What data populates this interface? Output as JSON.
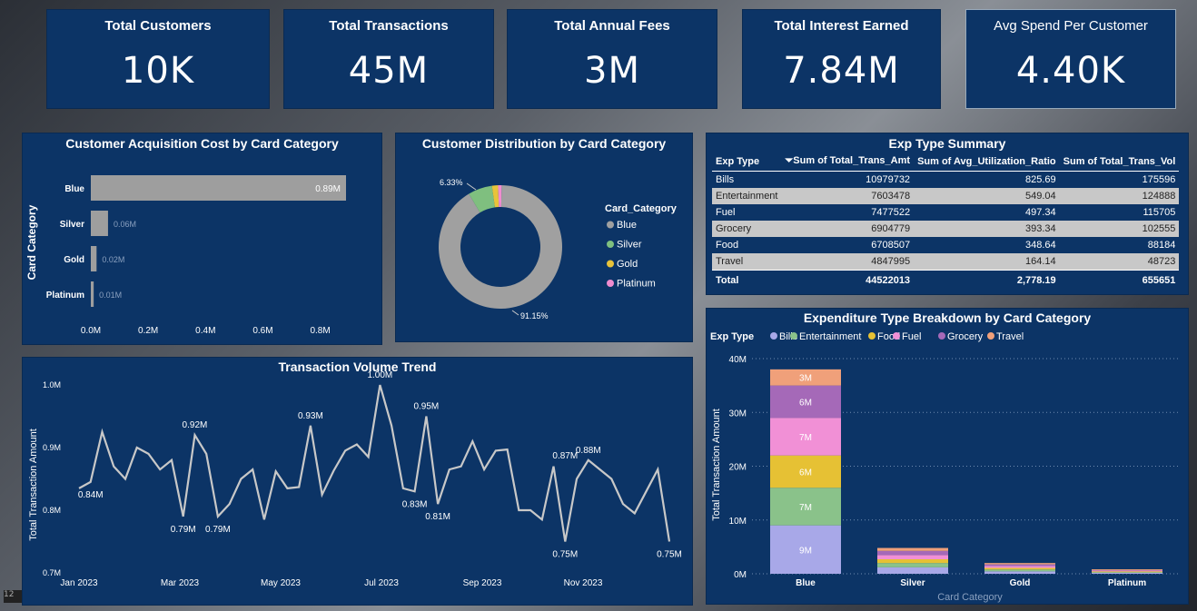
{
  "kpis": [
    {
      "title": "Total Customers",
      "value": "10K"
    },
    {
      "title": "Total Transactions",
      "value": "45M"
    },
    {
      "title": "Total Annual Fees",
      "value": "3M"
    },
    {
      "title": "Total Interest Earned",
      "value": "7.84M"
    },
    {
      "title": "Avg Spend Per Customer",
      "value": "4.40K"
    }
  ],
  "corner_label": "12",
  "chart_data": [
    {
      "id": "cac",
      "type": "bar",
      "title": "Customer Acquisition Cost by Card Category",
      "ylabel": "Card Category",
      "categories": [
        "Blue",
        "Silver",
        "Gold",
        "Platinum"
      ],
      "values": [
        0.89,
        0.06,
        0.02,
        0.01
      ],
      "data_labels": [
        "0.89M",
        "0.06M",
        "0.02M",
        "0.01M"
      ],
      "xticks": [
        "0.0M",
        "0.2M",
        "0.4M",
        "0.6M",
        "0.8M"
      ],
      "xlim": [
        0,
        0.89
      ],
      "bar_color": "#9e9e9e"
    },
    {
      "id": "dist",
      "type": "pie",
      "title": "Customer Distribution by Card Category",
      "legend_title": "Card_Category",
      "slices": [
        {
          "name": "Blue",
          "value": 91.15,
          "color": "#a0a0a0"
        },
        {
          "name": "Silver",
          "value": 6.33,
          "color": "#7fbf7f"
        },
        {
          "name": "Gold",
          "value": 1.59,
          "color": "#e8c33a"
        },
        {
          "name": "Platinum",
          "value": 0.93,
          "color": "#f08ccf"
        }
      ],
      "data_labels": [
        "91.15%",
        "6.33%"
      ]
    },
    {
      "id": "trend",
      "type": "line",
      "title": "Transaction Volume Trend",
      "ylabel": "Total Transaction Amount",
      "ylim": [
        0.7,
        1.0
      ],
      "yticks": [
        "1.0M",
        "0.9M",
        "0.8M",
        "0.7M"
      ],
      "xticks": [
        "Jan 2023",
        "Mar 2023",
        "May 2023",
        "Jul 2023",
        "Sep 2023",
        "Nov 2023"
      ],
      "values": [
        0.835,
        0.845,
        0.925,
        0.87,
        0.85,
        0.9,
        0.89,
        0.865,
        0.88,
        0.79,
        0.92,
        0.89,
        0.79,
        0.81,
        0.85,
        0.865,
        0.785,
        0.862,
        0.835,
        0.837,
        0.935,
        0.825,
        0.863,
        0.895,
        0.905,
        0.885,
        1.0,
        0.935,
        0.835,
        0.83,
        0.95,
        0.81,
        0.865,
        0.87,
        0.91,
        0.865,
        0.895,
        0.897,
        0.8,
        0.8,
        0.785,
        0.87,
        0.75,
        0.85,
        0.88,
        0.865,
        0.85,
        0.81,
        0.795,
        0.83,
        0.865,
        0.75
      ],
      "labels": [
        {
          "i": 1,
          "text": "0.84M",
          "pos": "below"
        },
        {
          "i": 9,
          "text": "0.79M",
          "pos": "below"
        },
        {
          "i": 10,
          "text": "0.92M",
          "pos": "above"
        },
        {
          "i": 12,
          "text": "0.79M",
          "pos": "below"
        },
        {
          "i": 20,
          "text": "0.93M",
          "pos": "above"
        },
        {
          "i": 26,
          "text": "1.00M",
          "pos": "above"
        },
        {
          "i": 29,
          "text": "0.83M",
          "pos": "below"
        },
        {
          "i": 30,
          "text": "0.95M",
          "pos": "above"
        },
        {
          "i": 31,
          "text": "0.81M",
          "pos": "below"
        },
        {
          "i": 42,
          "text": "0.75M",
          "pos": "below"
        },
        {
          "i": 42,
          "text": "0.87M",
          "pos": "above87"
        },
        {
          "i": 44,
          "text": "0.88M",
          "pos": "above"
        },
        {
          "i": 51,
          "text": "0.75M",
          "pos": "below"
        }
      ],
      "line_color": "#c8c8c8"
    },
    {
      "id": "stack",
      "type": "bar",
      "title": "Expenditure Type Breakdown by Card Category",
      "legend_title": "Exp Type",
      "ylabel": "Total Transaction Amount",
      "xlabel": "Card Category",
      "ylim": [
        0,
        40
      ],
      "yticks": [
        "40M",
        "30M",
        "20M",
        "10M",
        "0M"
      ],
      "categories": [
        "Blue",
        "Silver",
        "Gold",
        "Platinum"
      ],
      "series": [
        {
          "name": "Bills",
          "color": "#a8a8e8",
          "values": [
            9,
            1.2,
            0.45,
            0.2
          ],
          "label": "9M"
        },
        {
          "name": "Entertainment",
          "color": "#8ac28a",
          "values": [
            7,
            0.8,
            0.35,
            0.15
          ],
          "label": "7M"
        },
        {
          "name": "Food",
          "color": "#e6c134",
          "values": [
            6,
            0.7,
            0.3,
            0.12
          ],
          "label": "6M"
        },
        {
          "name": "Fuel",
          "color": "#f190d6",
          "values": [
            7,
            0.8,
            0.35,
            0.14
          ],
          "label": "7M"
        },
        {
          "name": "Grocery",
          "color": "#a569b8",
          "values": [
            6,
            0.75,
            0.3,
            0.12
          ],
          "label": "6M"
        },
        {
          "name": "Travel",
          "color": "#f0a07a",
          "values": [
            3,
            0.55,
            0.25,
            0.1
          ],
          "label": "3M"
        }
      ]
    }
  ],
  "summary_table": {
    "title": "Exp Type Summary",
    "columns": [
      "Exp Type",
      "Sum of Total_Trans_Amt",
      "Sum of Avg_Utilization_Ratio",
      "Sum of Total_Trans_Vol"
    ],
    "rows": [
      [
        "Bills",
        "10979732",
        "825.69",
        "175596"
      ],
      [
        "Entertainment",
        "7603478",
        "549.04",
        "124888"
      ],
      [
        "Fuel",
        "7477522",
        "497.34",
        "115705"
      ],
      [
        "Grocery",
        "6904779",
        "393.34",
        "102555"
      ],
      [
        "Food",
        "6708507",
        "348.64",
        "88184"
      ],
      [
        "Travel",
        "4847995",
        "164.14",
        "48723"
      ]
    ],
    "total": [
      "Total",
      "44522013",
      "2,778.19",
      "655651"
    ]
  }
}
